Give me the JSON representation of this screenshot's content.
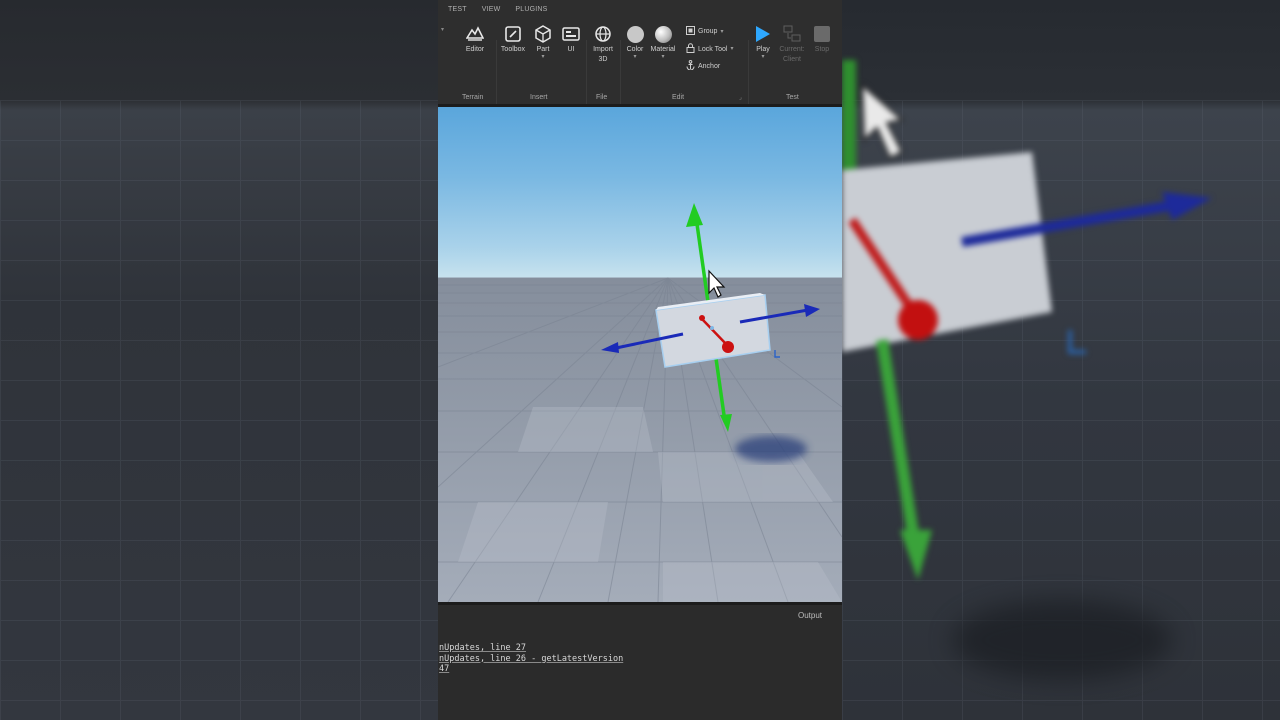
{
  "menu": {
    "tabs": [
      "TEST",
      "VIEW",
      "PLUGINS"
    ]
  },
  "ribbon": {
    "terrain": {
      "editor_label": "Editor",
      "group_label": "Terrain"
    },
    "insert": {
      "toolbox_label": "Toolbox",
      "part_label": "Part",
      "ui_label": "UI",
      "group_label": "Insert"
    },
    "file": {
      "import_label": "Import",
      "import_sub": "3D",
      "group_label": "File"
    },
    "edit": {
      "color_label": "Color",
      "material_label": "Material",
      "group_tool": "Group",
      "lock_tool": "Lock Tool",
      "anchor_tool": "Anchor",
      "group_label": "Edit"
    },
    "test": {
      "play_label": "Play",
      "current_label": "Current:",
      "client_label": "Client",
      "stop_label": "Stop",
      "group_label": "Test"
    }
  },
  "output": {
    "title": "Output",
    "lines": [
      "nUpdates, line 27",
      "nUpdates, line 26 - getLatestVersion",
      "47"
    ]
  },
  "icons": [
    "terrain-editor-icon",
    "toolbox-icon",
    "part-cube-icon",
    "ui-icon",
    "import-3d-globe-icon",
    "color-icon",
    "material-icon",
    "group-icon",
    "lock-icon",
    "anchor-icon",
    "play-icon",
    "current-client-icon",
    "stop-icon",
    "mouse-cursor-icon"
  ],
  "colors": {
    "accent_play": "#2ea8ff",
    "axis_y": "#22cc22",
    "axis_z": "#1a2ab8",
    "axis_x": "#cc1111",
    "sky": "#5aa6dc"
  }
}
